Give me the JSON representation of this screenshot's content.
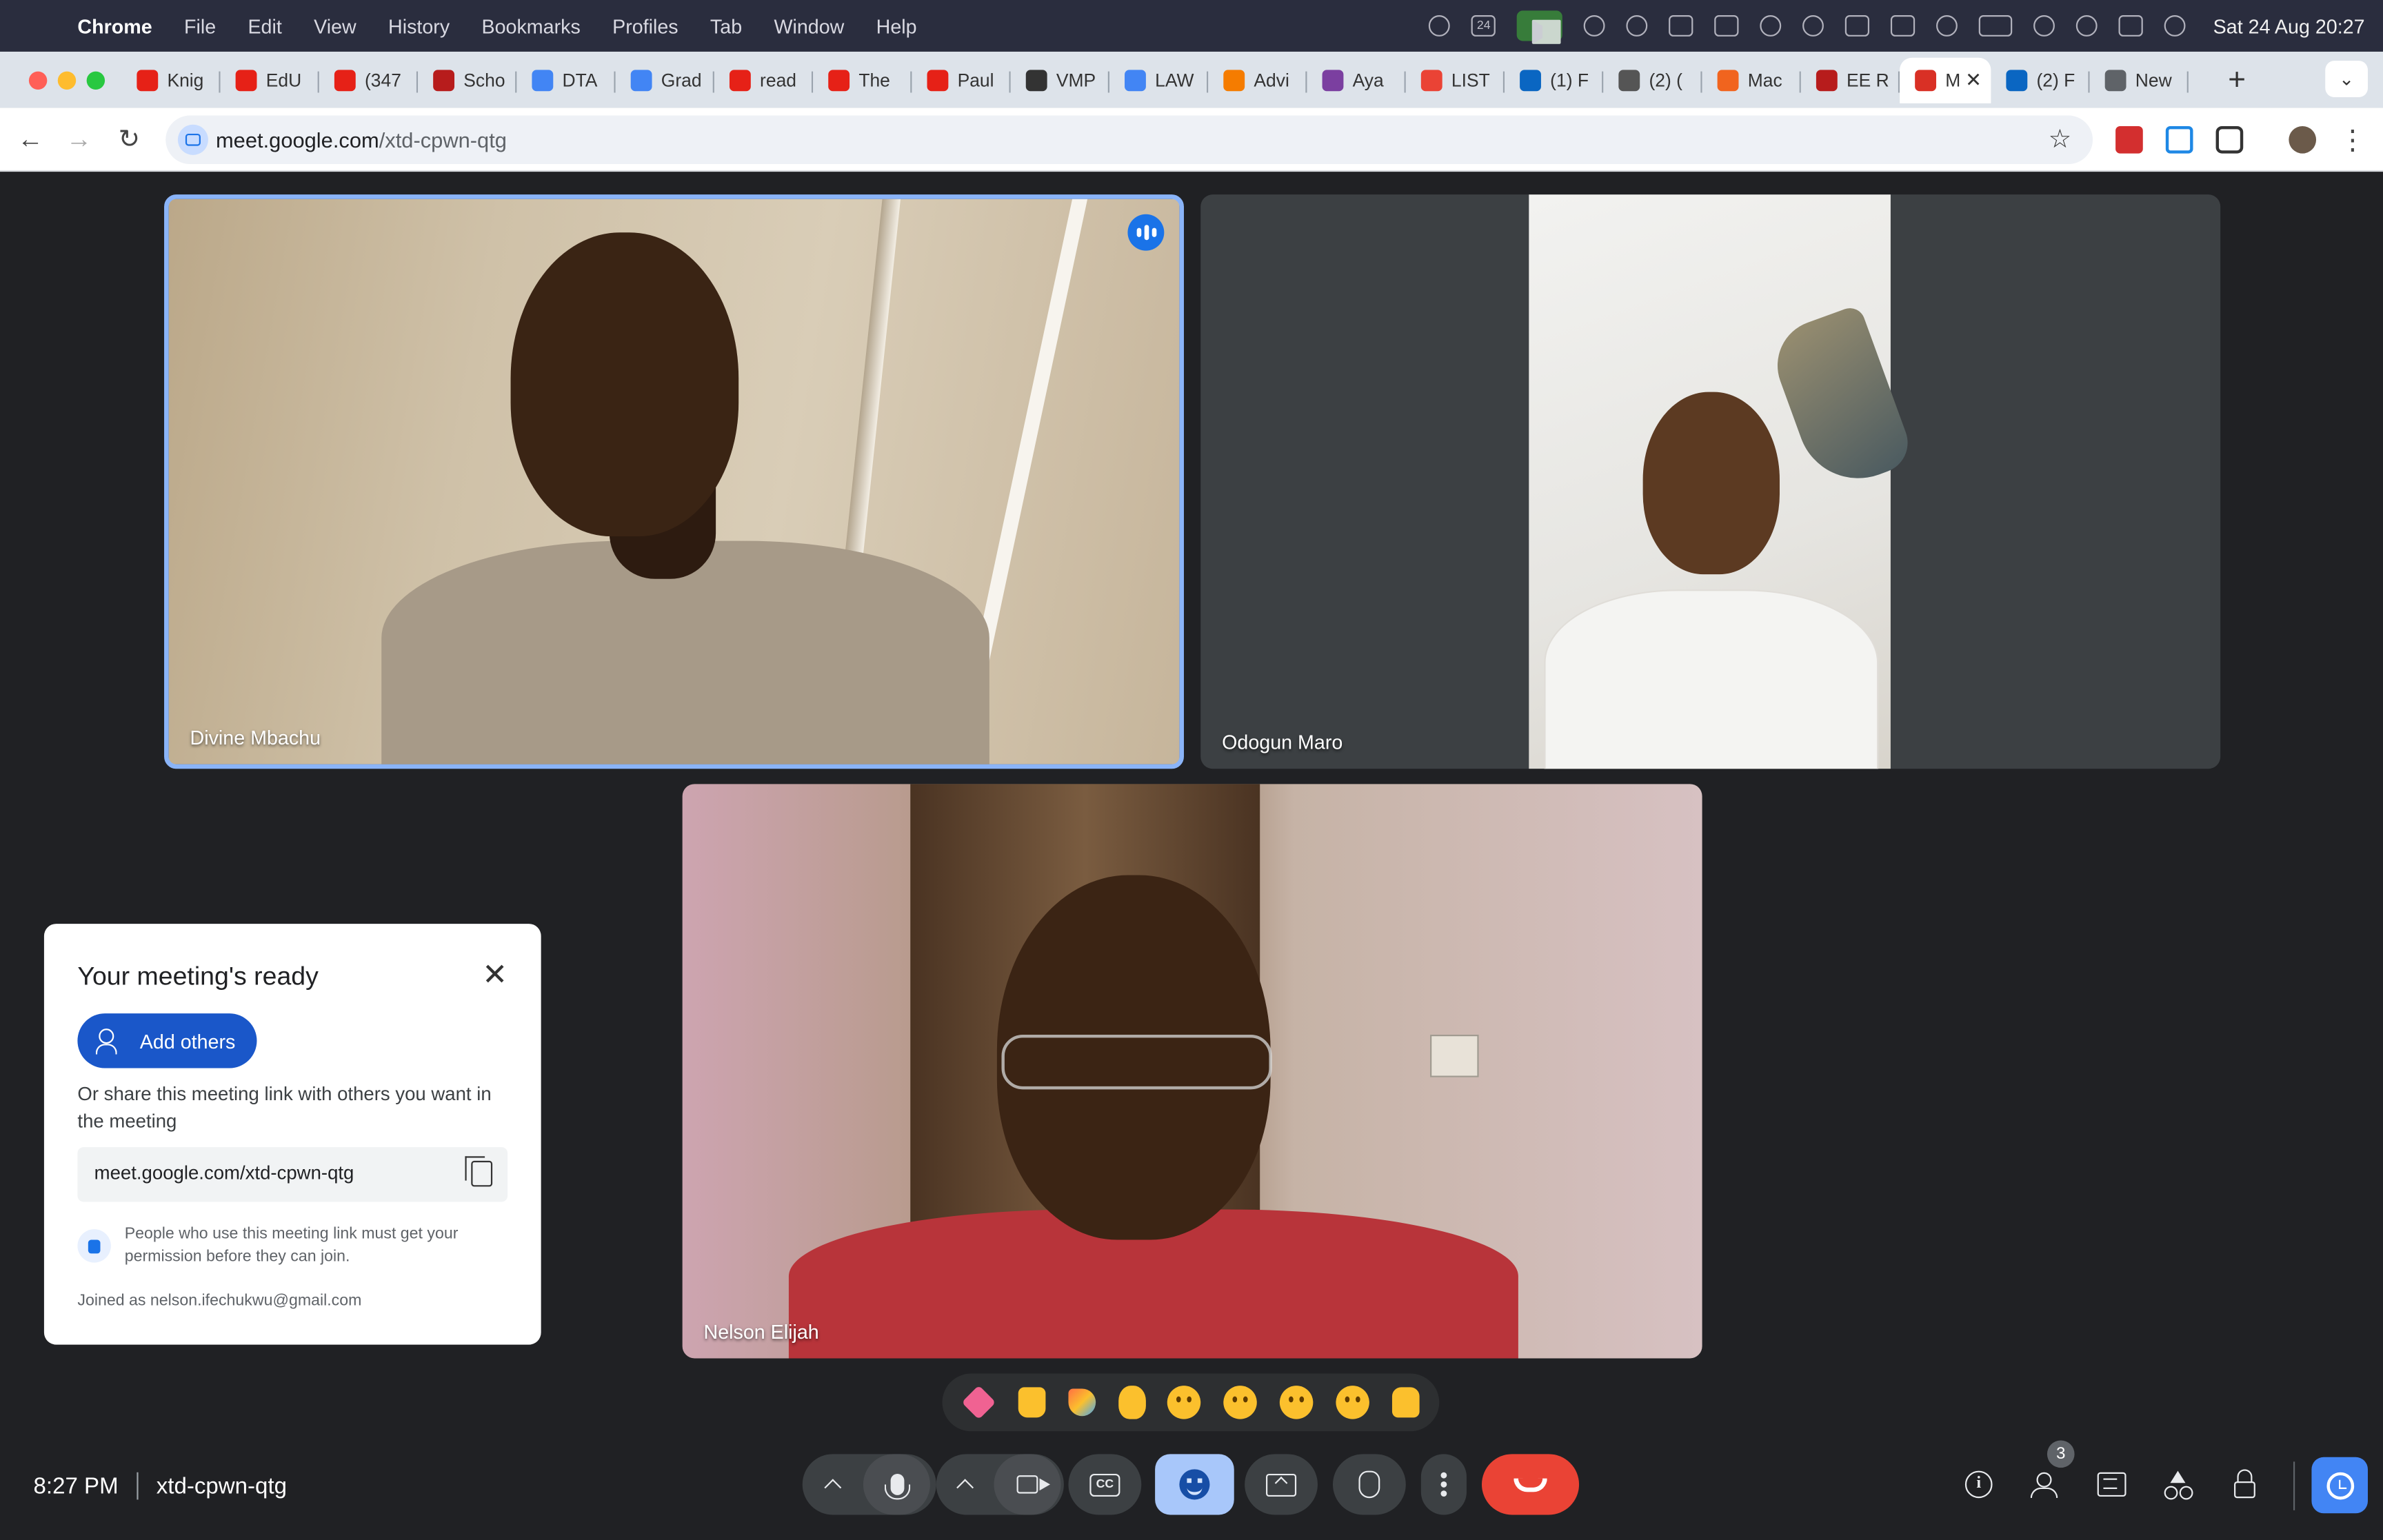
{
  "menubar": {
    "app": "Chrome",
    "items": [
      "File",
      "Edit",
      "View",
      "History",
      "Bookmarks",
      "Profiles",
      "Tab",
      "Window",
      "Help"
    ],
    "clock": "Sat 24 Aug  20:27",
    "calendar_day": "24"
  },
  "tabs": [
    {
      "label": "Knig",
      "icon": "youtube-icon",
      "color": "#e62117"
    },
    {
      "label": "EdU",
      "icon": "youtube-icon",
      "color": "#e62117"
    },
    {
      "label": "(347",
      "icon": "youtube-icon",
      "color": "#e62117"
    },
    {
      "label": "Scho",
      "icon": "scribd-icon",
      "color": "#b71c1c"
    },
    {
      "label": "DTA",
      "icon": "docs-icon",
      "color": "#4285f4"
    },
    {
      "label": "Grad",
      "icon": "docs-icon",
      "color": "#4285f4"
    },
    {
      "label": "read",
      "icon": "youtube-icon",
      "color": "#e62117"
    },
    {
      "label": "The",
      "icon": "youtube-icon",
      "color": "#e62117"
    },
    {
      "label": "Paul",
      "icon": "youtube-icon",
      "color": "#e62117"
    },
    {
      "label": "VMP",
      "icon": "vmp-icon",
      "color": "#333333"
    },
    {
      "label": "LAW",
      "icon": "docs-icon",
      "color": "#4285f4"
    },
    {
      "label": "Advi",
      "icon": "blogger-icon",
      "color": "#f57c00"
    },
    {
      "label": "Aya",
      "icon": "app-icon",
      "color": "#7b3fa0"
    },
    {
      "label": "LIST",
      "icon": "gmail-icon",
      "color": "#ea4335"
    },
    {
      "label": "(1) F",
      "icon": "linkedin-icon",
      "color": "#0a66c2"
    },
    {
      "label": "(2) (",
      "icon": "researchgate-icon",
      "color": "#555555"
    },
    {
      "label": "Mac",
      "icon": "etsy-icon",
      "color": "#f1641e"
    },
    {
      "label": "EE R",
      "icon": "scribd-icon",
      "color": "#b71c1c"
    },
    {
      "label": "M",
      "icon": "recording-icon",
      "color": "#d93025",
      "active": true
    },
    {
      "label": "(2) F",
      "icon": "linkedin-icon",
      "color": "#0a66c2"
    },
    {
      "label": "New",
      "icon": "chrome-icon",
      "color": "#5f6368"
    }
  ],
  "address": {
    "host": "meet.google.com",
    "path": "/xtd-cpwn-qtg"
  },
  "participants": [
    {
      "name": "Divine Mbachu",
      "speaking": true
    },
    {
      "name": "Odogun Maro"
    },
    {
      "name": "Nelson Elijah"
    }
  ],
  "card": {
    "title": "Your meeting's ready",
    "add_button": "Add others",
    "share_text": "Or share this meeting link with others you want in the meeting",
    "link": "meet.google.com/xtd-cpwn-qtg",
    "permission_text": "People who use this meeting link must get your permission before they can join.",
    "joined_as": "Joined as nelson.ifechukwu@gmail.com"
  },
  "reactions": [
    "sparkling-heart",
    "thumbs-up",
    "party-popper",
    "clapping-hands",
    "tears-of-joy",
    "surprised",
    "sad",
    "thinking",
    "thumbs-down"
  ],
  "bottom": {
    "time": "8:27 PM",
    "meeting_code": "xtd-cpwn-qtg",
    "cc_label": "CC",
    "participant_count": "3"
  }
}
